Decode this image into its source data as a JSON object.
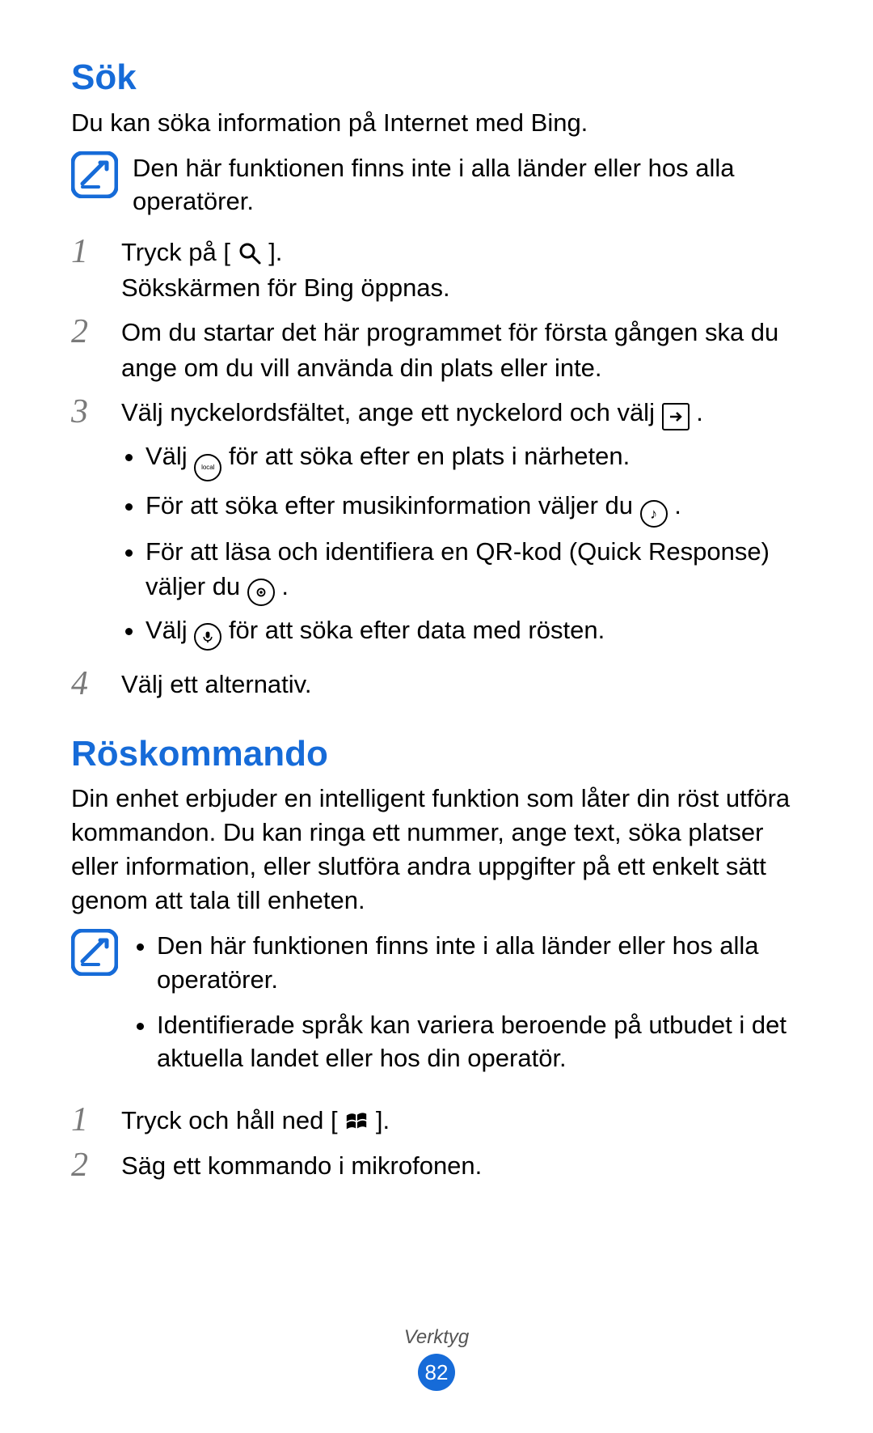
{
  "section1": {
    "heading": "Sök",
    "intro": "Du kan söka information på Internet med Bing.",
    "note": "Den här funktionen finns inte i alla länder eller hos alla operatörer.",
    "steps": {
      "s1_num": "1",
      "s1a": "Tryck på [",
      "s1b": "].",
      "s1_line2": "Sökskärmen för Bing öppnas.",
      "s2_num": "2",
      "s2": "Om du startar det här programmet för första gången ska du ange om du vill använda din plats eller inte.",
      "s3_num": "3",
      "s3a": "Välj nyckelordsfältet, ange ett nyckelord och välj ",
      "s3b": ".",
      "s3_b1a": "Välj ",
      "s3_b1b": " för att söka efter en plats i närheten.",
      "s3_b2a": "För att söka efter musikinformation väljer du ",
      "s3_b2b": ".",
      "s3_b3a": "För att läsa och identifiera en QR-kod (Quick Response) väljer du ",
      "s3_b3b": ".",
      "s3_b4a": "Välj ",
      "s3_b4b": " för att söka efter data med rösten.",
      "s4_num": "4",
      "s4": "Välj ett alternativ."
    }
  },
  "section2": {
    "heading": "Röskommando",
    "intro": "Din enhet erbjuder en intelligent funktion som låter din röst utföra kommandon. Du kan ringa ett nummer, ange text, söka platser eller information, eller slutföra andra uppgifter på ett enkelt sätt genom att tala till enheten.",
    "note_b1": "Den här funktionen finns inte i alla länder eller hos alla operatörer.",
    "note_b2": "Identifierade språk kan variera beroende på utbudet i det aktuella landet eller hos din operatör.",
    "steps": {
      "s1_num": "1",
      "s1a": "Tryck och håll ned [ ",
      "s1b": " ].",
      "s2_num": "2",
      "s2": "Säg ett kommando i mikrofonen."
    }
  },
  "footer": {
    "section_name": "Verktyg",
    "page_number": "82"
  }
}
